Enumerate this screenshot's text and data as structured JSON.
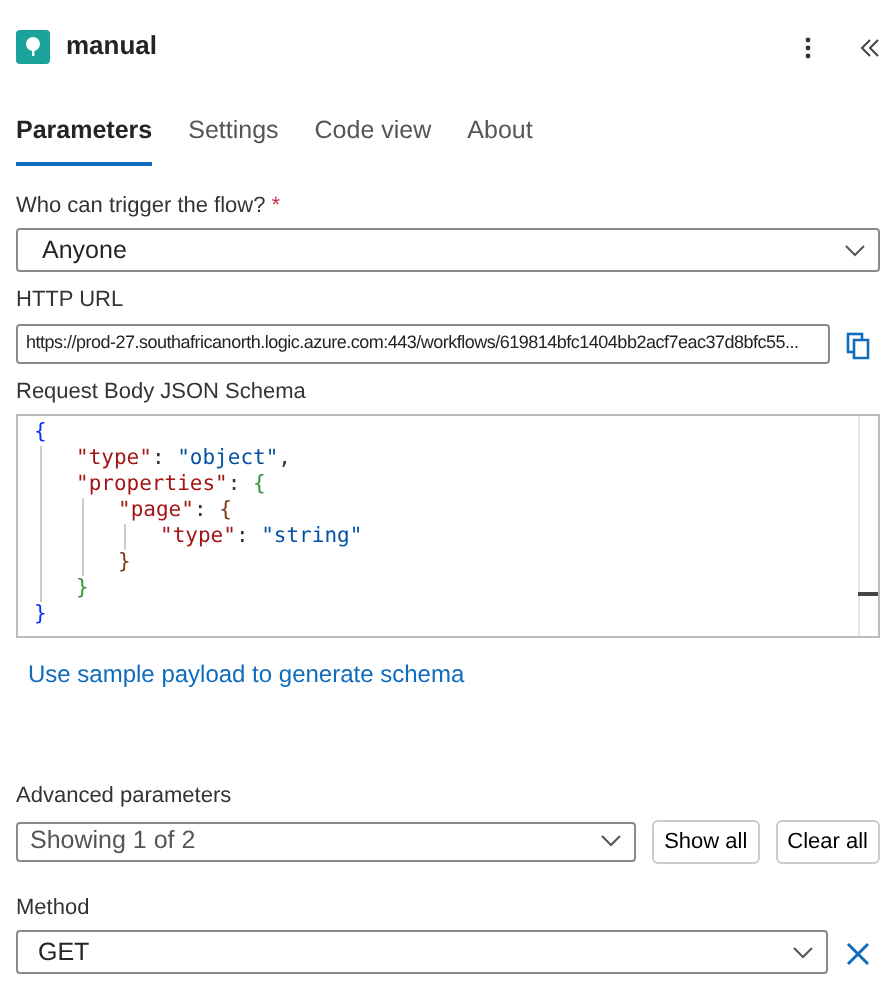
{
  "header": {
    "title": "manual"
  },
  "tabs": [
    {
      "label": "Parameters",
      "selected": true
    },
    {
      "label": "Settings",
      "selected": false
    },
    {
      "label": "Code view",
      "selected": false
    },
    {
      "label": "About",
      "selected": false
    }
  ],
  "trigger": {
    "label": "Who can trigger the flow?",
    "required_mark": "*",
    "value": "Anyone"
  },
  "http_url": {
    "label": "HTTP URL",
    "value": "https://prod-27.southafricanorth.logic.azure.com:443/workflows/619814bfc1404bb2acf7eac37d8bfc55..."
  },
  "schema": {
    "label": "Request Body JSON Schema",
    "code": [
      {
        "open": [
          {
            "kind": "brace",
            "text": "{",
            "color": "#0431fa"
          }
        ],
        "close": [
          {
            "kind": "brace",
            "text": "}",
            "color": "#0431fa"
          }
        ],
        "children": [
          {
            "open": [
              {
                "kind": "key",
                "text": "\"type\""
              },
              {
                "kind": "punct",
                "text": ": "
              },
              {
                "kind": "string",
                "text": "\"object\""
              },
              {
                "kind": "punct",
                "text": ","
              }
            ]
          },
          {
            "open": [
              {
                "kind": "key",
                "text": "\"properties\""
              },
              {
                "kind": "punct",
                "text": ": "
              },
              {
                "kind": "brace",
                "text": "{",
                "color": "#319331"
              }
            ],
            "close": [
              {
                "kind": "brace",
                "text": "}",
                "color": "#319331"
              }
            ],
            "children": [
              {
                "open": [
                  {
                    "kind": "key",
                    "text": "\"page\""
                  },
                  {
                    "kind": "punct",
                    "text": ": "
                  },
                  {
                    "kind": "brace",
                    "text": "{",
                    "color": "#7b3814"
                  }
                ],
                "close": [
                  {
                    "kind": "brace",
                    "text": "}",
                    "color": "#7b3814"
                  }
                ],
                "children": [
                  {
                    "open": [
                      {
                        "kind": "key",
                        "text": "\"type\""
                      },
                      {
                        "kind": "punct",
                        "text": ": "
                      },
                      {
                        "kind": "string",
                        "text": "\"string\""
                      }
                    ]
                  }
                ]
              }
            ]
          }
        ]
      }
    ],
    "link": "Use sample payload to generate schema"
  },
  "advanced": {
    "label": "Advanced parameters",
    "value": "Showing 1 of 2",
    "buttons": [
      "Show all",
      "Clear all"
    ]
  },
  "method": {
    "label": "Method",
    "value": "GET"
  }
}
